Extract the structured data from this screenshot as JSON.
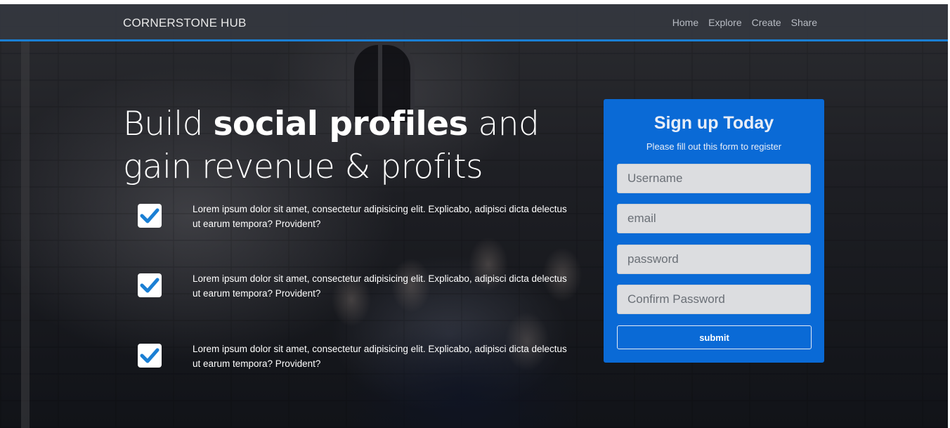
{
  "navbar": {
    "brand": "CORNERSTONE HUB",
    "links": [
      "Home",
      "Explore",
      "Create",
      "Share"
    ]
  },
  "hero": {
    "headline_pre": "Build ",
    "headline_bold": "social profiles",
    "headline_post": " and gain revenue & profits",
    "features": [
      "Lorem ipsum dolor sit amet, consectetur adipisicing elit. Explicabo, adipisci dicta delectus ut earum tempora? Provident?",
      "Lorem ipsum dolor sit amet, consectetur adipisicing elit. Explicabo, adipisci dicta delectus ut earum tempora? Provident?",
      "Lorem ipsum dolor sit amet, consectetur adipisicing elit. Explicabo, adipisci dicta delectus ut earum tempora? Provident?"
    ],
    "check_icon": "checkmark-icon"
  },
  "signup": {
    "title": "Sign up Today",
    "subtitle": "Please fill out this form to register",
    "fields": {
      "username_placeholder": "Username",
      "email_placeholder": "email",
      "password_placeholder": "password",
      "confirm_placeholder": "Confirm Password"
    },
    "submit_label": "submit"
  },
  "colors": {
    "accent": "#0a6ad6",
    "navbar_underline": "#1a7fd4",
    "check": "#1a7fd4"
  }
}
